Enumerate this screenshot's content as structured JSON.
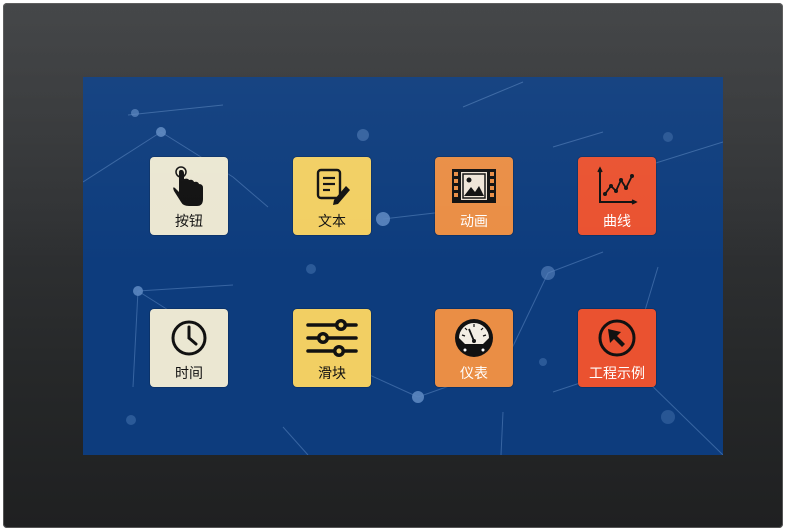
{
  "colors": {
    "bezel": "#2c2e30",
    "screen_bg": "#0d3c7d",
    "tile_cream": "#ebe7d2",
    "tile_yellow": "#f2cf63",
    "tile_orange": "#ea8e45",
    "tile_red": "#ea5230"
  },
  "menu": {
    "tiles": [
      {
        "label": "按钮",
        "icon": "hand-touch-icon",
        "color": "#ebe7d2"
      },
      {
        "label": "文本",
        "icon": "document-edit-icon",
        "color": "#f2cf63"
      },
      {
        "label": "动画",
        "icon": "film-picture-icon",
        "color": "#ea8e45"
      },
      {
        "label": "曲线",
        "icon": "line-chart-icon",
        "color": "#ea5230"
      },
      {
        "label": "时间",
        "icon": "clock-icon",
        "color": "#ebe7d2"
      },
      {
        "label": "滑块",
        "icon": "sliders-icon",
        "color": "#f2cf63"
      },
      {
        "label": "仪表",
        "icon": "gauge-meter-icon",
        "color": "#ea8e45"
      },
      {
        "label": "工程示例",
        "icon": "cursor-arrow-icon",
        "color": "#ea5230"
      }
    ]
  }
}
